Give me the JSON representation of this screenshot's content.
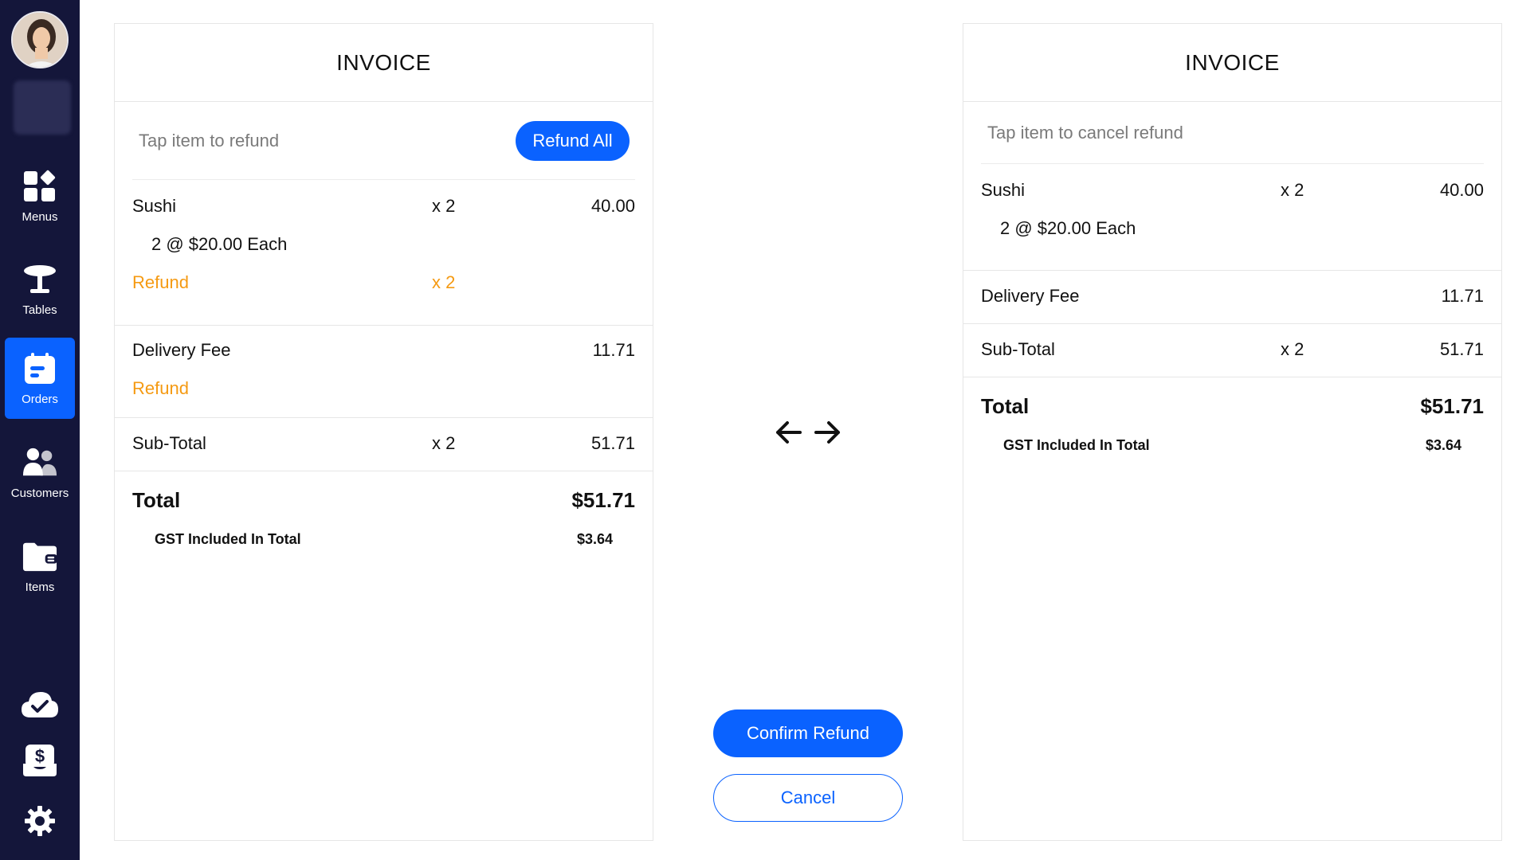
{
  "sidebar": {
    "items": [
      {
        "label": "Menus",
        "icon": "menus-grid-icon"
      },
      {
        "label": "Tables",
        "icon": "table-icon"
      },
      {
        "label": "Orders",
        "icon": "orders-icon",
        "active": true
      },
      {
        "label": "Customers",
        "icon": "customers-icon"
      },
      {
        "label": "Items",
        "icon": "items-folder-icon"
      }
    ],
    "bottom_icons": [
      "cloud-check-icon",
      "cash-drawer-icon",
      "gear-icon"
    ]
  },
  "left_invoice": {
    "title": "INVOICE",
    "hint": "Tap item to refund",
    "refund_all_label": "Refund All",
    "sushi": {
      "name": "Sushi",
      "qty": "x 2",
      "amount": "40.00",
      "detail": "2 @ $20.00 Each",
      "refund_label": "Refund",
      "refund_qty": "x 2"
    },
    "delivery": {
      "name": "Delivery Fee",
      "amount": "11.71",
      "refund_label": "Refund"
    },
    "subtotal": {
      "name": "Sub-Total",
      "qty": "x 2",
      "amount": "51.71"
    },
    "total": {
      "name": "Total",
      "amount": "$51.71"
    },
    "gst": {
      "name": "GST Included In Total",
      "amount": "$3.64"
    }
  },
  "right_invoice": {
    "title": "INVOICE",
    "hint": "Tap item to cancel refund",
    "sushi": {
      "name": "Sushi",
      "qty": "x 2",
      "amount": "40.00",
      "detail": "2 @ $20.00 Each"
    },
    "delivery": {
      "name": "Delivery Fee",
      "amount": "11.71"
    },
    "subtotal": {
      "name": "Sub-Total",
      "qty": "x 2",
      "amount": "51.71"
    },
    "total": {
      "name": "Total",
      "amount": "$51.71"
    },
    "gst": {
      "name": "GST Included In Total",
      "amount": "$3.64"
    }
  },
  "actions": {
    "confirm_label": "Confirm Refund",
    "cancel_label": "Cancel"
  },
  "colors": {
    "accent": "#0a62ff",
    "sidebar": "#14163a",
    "refund": "#f59a12"
  }
}
